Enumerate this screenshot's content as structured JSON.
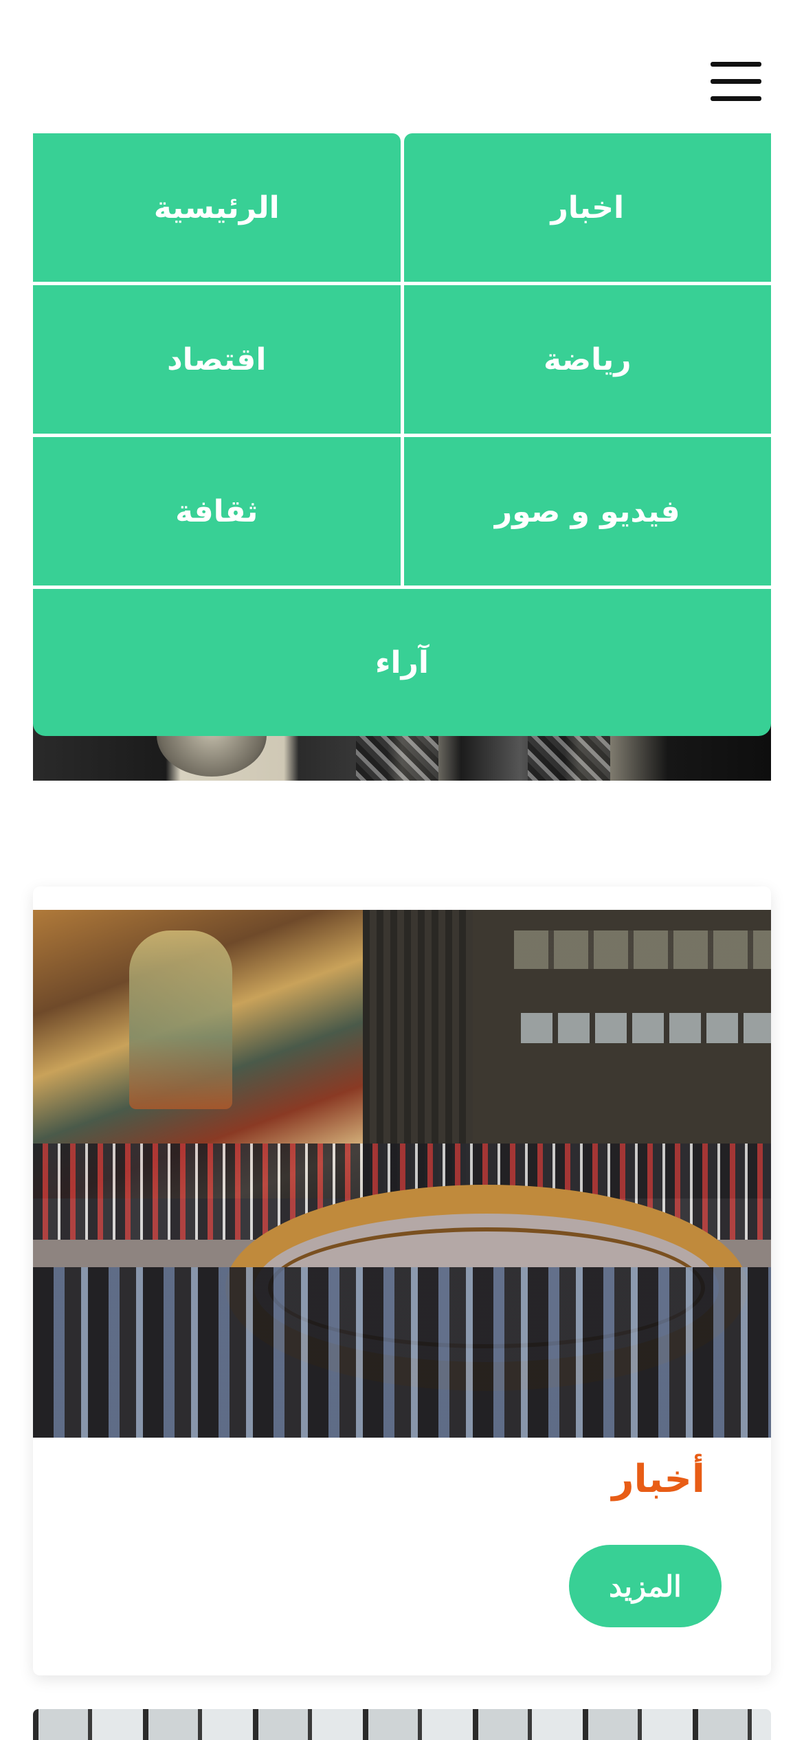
{
  "header": {
    "menu_icon": "hamburger-menu-icon"
  },
  "menu": {
    "items": [
      {
        "label": "اخبار"
      },
      {
        "label": "الرئيسية"
      },
      {
        "label": "رياضة"
      },
      {
        "label": "اقتصاد"
      },
      {
        "label": "فيديو و صور"
      },
      {
        "label": "ثقافة"
      }
    ],
    "wide_item": {
      "label": "آراء"
    }
  },
  "card": {
    "tag": "أخبار",
    "button_label": "المزيد"
  },
  "colors": {
    "accent_green": "#38d095",
    "tag_orange": "#e85d16"
  }
}
